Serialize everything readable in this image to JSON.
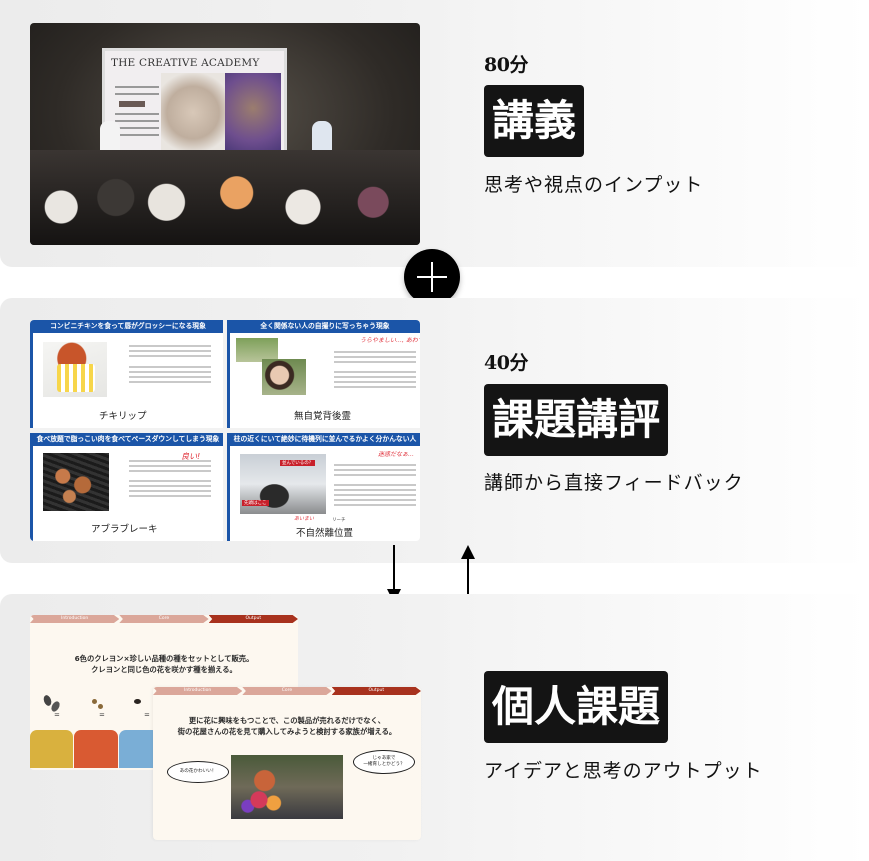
{
  "sections": [
    {
      "duration": "80分",
      "title": "講義",
      "description": "思考や視点のインプット",
      "image": {
        "type": "photo",
        "alt": "lecture photo",
        "screen_title": "THE CREATIVE ACADEMY"
      }
    },
    {
      "duration": "40分",
      "title": "課題講評",
      "description": "講師から直接フィードバック",
      "image": {
        "type": "slides",
        "slides": [
          {
            "header": "コンビニチキンを食って唇がグロッシーになる現象",
            "name": "チキリップ"
          },
          {
            "header": "全く関係ない人の自撮りに写っちゃう現象",
            "name": "無自覚背後霊",
            "note": "うらやましい…, あわてて隠れる"
          },
          {
            "header": "食べ放題で脂っこい肉を食べてペースダウンしてしまう現象",
            "name": "アブラブレーキ",
            "note": "良い!"
          },
          {
            "header": "柱の近くにいて絶妙に待機列に並んでるかよく分かんない人",
            "name": "不自然離位置",
            "note": "迷惑だなぁ…",
            "annotation_above": "あいまい",
            "annotation_ruby": "リーチ",
            "tag1": "並んでいるの？",
            "tag2": "先頭はここ"
          }
        ]
      }
    },
    {
      "title": "個人課題",
      "description": "アイデアと思考のアウトプット",
      "image": {
        "type": "slides",
        "steps": [
          "Introduction",
          "Core",
          "Output"
        ],
        "slide_a_text": [
          "6色のクレヨン×珍しい品種の種をセットとして販売。",
          "クレヨンと同じ色の花を咲かす種を揃える。"
        ],
        "slide_b_text": [
          "更に花に興味をもつことで、この製品が売れるだけでなく、",
          "街の花屋さんの花を見て購入してみようと検討する家族が増える。"
        ],
        "bubble_left": "あの花かわいい！",
        "bubble_right": [
          "じゃあ家で",
          "一緒育しとかどう？"
        ],
        "equals": "="
      }
    }
  ],
  "connectors": {
    "plus": "plus-icon",
    "down_arrow": "arrow-down-icon",
    "up_arrow": "arrow-up-icon"
  },
  "colors": {
    "badge_bg": "#141414",
    "badge_text": "#ffffff",
    "slide_header_blue": "#1b55a8",
    "step_inactive": "#dba79a",
    "step_active": "#a8321e",
    "crayon_yellow": "#d9b13e",
    "crayon_orange": "#d95a32",
    "crayon_blue": "#7aaed6"
  }
}
